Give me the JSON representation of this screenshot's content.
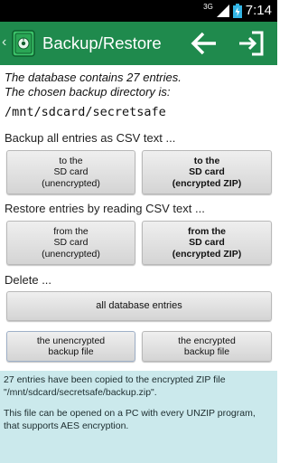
{
  "status_bar": {
    "network": "3G",
    "time": "7:14"
  },
  "action_bar": {
    "title": "Backup/Restore",
    "back_icon": "arrow-left-icon",
    "exit_icon": "exit-icon",
    "app_icon": "safe-icon",
    "bg_color": "#1f8a4d"
  },
  "info": {
    "line1": "The database contains 27 entries.",
    "line2": "The chosen backup directory is:",
    "path": "/mnt/sdcard/secretsafe"
  },
  "backup": {
    "heading": "Backup all entries as CSV text ...",
    "unencrypted_label": "to the\nSD card\n(unencrypted)",
    "encrypted_label": "to the\nSD card\n(encrypted ZIP)"
  },
  "restore": {
    "heading": "Restore entries by reading CSV text ...",
    "unencrypted_label": "from the\nSD card\n(unencrypted)",
    "encrypted_label": "from the\nSD card\n(encrypted ZIP)"
  },
  "delete": {
    "heading": "Delete ...",
    "all_entries_label": "all database entries",
    "unencrypted_file_label": "the unencrypted\nbackup file",
    "encrypted_file_label": "the encrypted\nbackup file"
  },
  "result": {
    "message1": "27 entries have been copied to the encrypted ZIP file \"/mnt/sdcard/secretsafe/backup.zip\".",
    "message2": "This file can be opened on a PC with every UNZIP program, that supports AES encryption.",
    "bg_color": "#cbe9ec"
  }
}
